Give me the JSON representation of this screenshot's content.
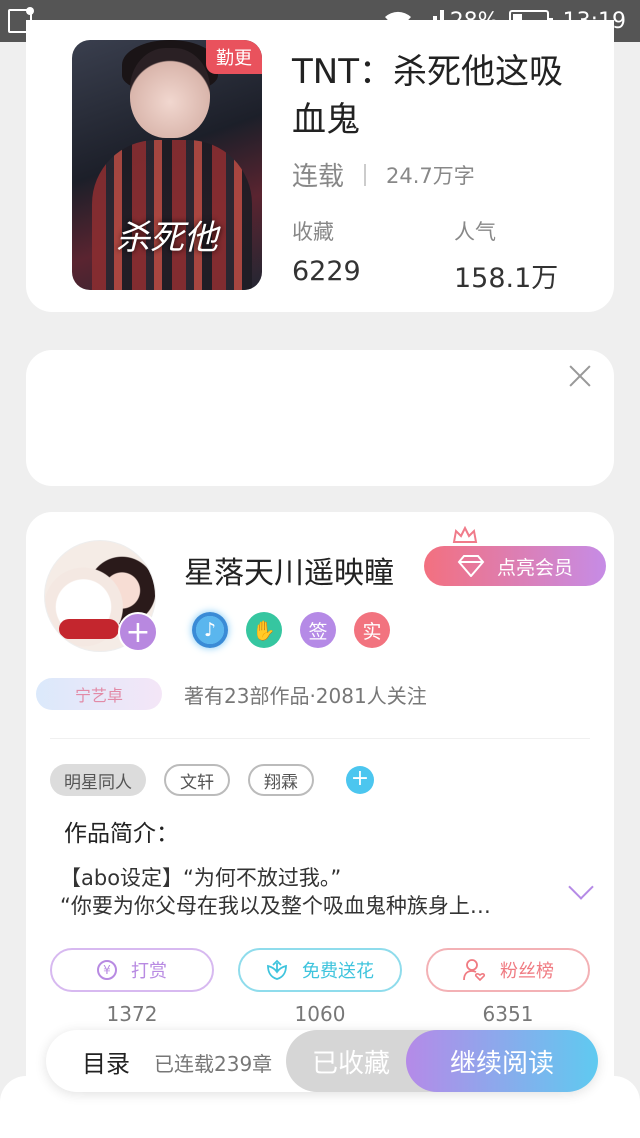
{
  "status_bar": {
    "battery_percent": "28%",
    "battery_level": 0.28,
    "time": "13:19"
  },
  "book": {
    "update_badge": "勤更",
    "cover_title": "杀死他",
    "title": "TNT：杀死他这吸血鬼",
    "status": "连载",
    "word_count": "24.7万字",
    "favorites_label": "收藏",
    "favorites_value": "6229",
    "popularity_label": "人气",
    "popularity_value": "158.1万"
  },
  "author": {
    "name": "星落天川遥映瞳",
    "vip_button": "点亮会员",
    "badges": [
      "签",
      "实"
    ],
    "fan_tag": "宁艺卓",
    "meta": "著有23部作品·2081人关注",
    "follow_plus": "+"
  },
  "tags": [
    "明星同人",
    "文轩",
    "翔霖"
  ],
  "intro": {
    "label": "作品简介：",
    "line1": "【abo设定】“为何不放过我。”",
    "line2": "“你要为你父母在我以及整个吸血鬼种族身上…"
  },
  "actions": [
    {
      "label": "打赏",
      "count": "1372"
    },
    {
      "label": "免费送花",
      "count": "1060"
    },
    {
      "label": "粉丝榜",
      "count": "6351"
    }
  ],
  "bottom_bar": {
    "toc": "目录",
    "chapters": "已连载239章",
    "collected": "已收藏",
    "continue": "继续阅读"
  },
  "colors": {
    "accent_purple": "#b58ae8",
    "accent_blue": "#5fcaf0",
    "badge_red": "#e9525d"
  }
}
